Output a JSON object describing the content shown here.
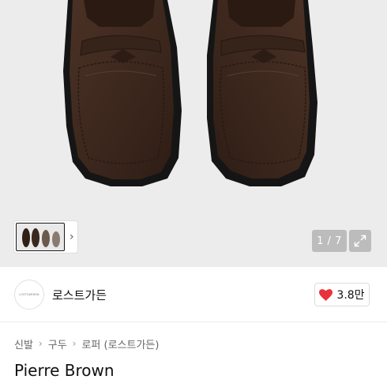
{
  "gallery": {
    "counter": "1 / 7",
    "thumbnail_chevron": "›",
    "icons": {
      "expand": "expand-icon",
      "chevron": "chevron-right-icon"
    },
    "colors": {
      "background": "#ececec",
      "shoe": "#3f2a1f",
      "sole": "#141414"
    }
  },
  "seller": {
    "logo_text": "LOSTGARDEN",
    "name": "로스트가든",
    "likes": "3.8만",
    "icons": {
      "like": "heart-icon"
    },
    "colors": {
      "heart": "#e8313a"
    }
  },
  "product": {
    "breadcrumb": [
      "신발",
      "구두",
      "로퍼 (로스트가든)"
    ],
    "title": "Pierre Brown"
  }
}
